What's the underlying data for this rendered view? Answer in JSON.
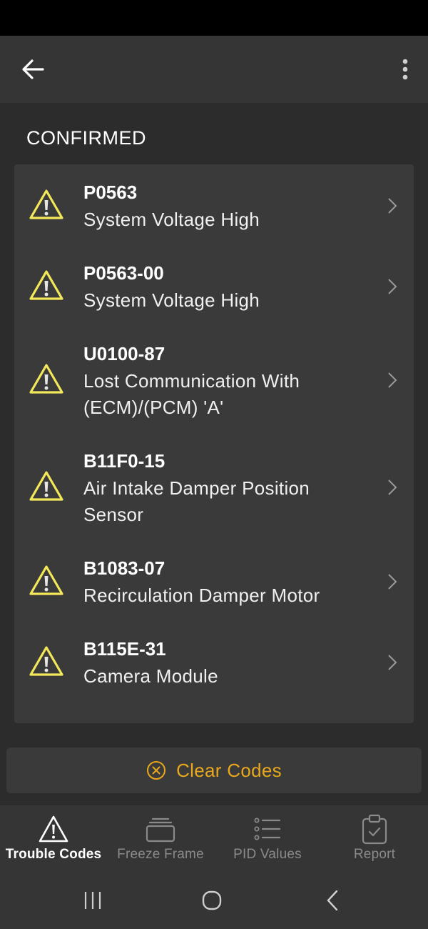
{
  "header": {
    "back_icon": "arrow-left-icon",
    "menu_icon": "more-vertical-icon"
  },
  "section": {
    "title": "CONFIRMED"
  },
  "trouble_codes": [
    {
      "code": "P0563",
      "description": "System Voltage High"
    },
    {
      "code": "P0563-00",
      "description": "System Voltage High"
    },
    {
      "code": "U0100-87",
      "description": "Lost Communication With (ECM)/(PCM) 'A'"
    },
    {
      "code": "B11F0-15",
      "description": "Air Intake Damper Position Sensor"
    },
    {
      "code": "B1083-07",
      "description": "Recirculation Damper Motor"
    },
    {
      "code": "B115E-31",
      "description": "Camera Module"
    }
  ],
  "actions": {
    "clear_codes": "Clear Codes"
  },
  "bottom_nav": {
    "tabs": [
      {
        "label": "Trouble Codes",
        "icon": "warning-triangle-icon",
        "active": true
      },
      {
        "label": "Freeze Frame",
        "icon": "stack-icon",
        "active": false
      },
      {
        "label": "PID Values",
        "icon": "list-icon",
        "active": false
      },
      {
        "label": "Report",
        "icon": "clipboard-check-icon",
        "active": false
      }
    ]
  },
  "colors": {
    "accent": "#e8a81e",
    "warning": "#f2e85a",
    "background": "#2c2c2c",
    "card": "#3a3a3a"
  }
}
